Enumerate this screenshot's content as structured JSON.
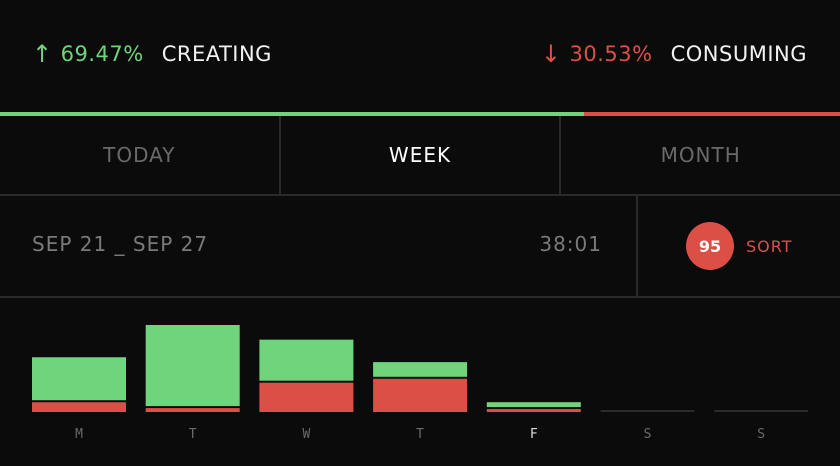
{
  "header": {
    "creating": {
      "arrow": "↑",
      "percent": "69.47%",
      "label": "CREATING",
      "color": "#6fd47c"
    },
    "consuming": {
      "arrow": "↓",
      "percent": "30.53%",
      "label": "CONSUMING",
      "color": "#dc4f47"
    }
  },
  "ratio": {
    "creating_fraction": 0.6947,
    "consuming_fraction": 0.3053
  },
  "tabs": [
    {
      "label": "TODAY",
      "active": false
    },
    {
      "label": "WEEK",
      "active": true
    },
    {
      "label": "MONTH",
      "active": false
    }
  ],
  "range": {
    "dates": "SEP 21 _ SEP 27",
    "duration": "38:01"
  },
  "sort": {
    "score": "95",
    "label": "SORT"
  },
  "colors": {
    "creating": "#6fd47c",
    "consuming": "#dc4f47",
    "empty": "#2a2a2a",
    "label": "#6a6a6a",
    "label_active": "#dddddd"
  },
  "chart_data": {
    "type": "bar",
    "categories": [
      "M",
      "T",
      "W",
      "T",
      "F",
      "S",
      "S"
    ],
    "active_category_index": 4,
    "series": [
      {
        "name": "",
        "values": [
          44,
          83,
          42,
          15,
          5,
          0,
          0
        ]
      },
      {
        "name": "",
        "values": [
          10,
          4,
          30,
          34,
          3,
          0,
          0
        ]
      }
    ]
  }
}
